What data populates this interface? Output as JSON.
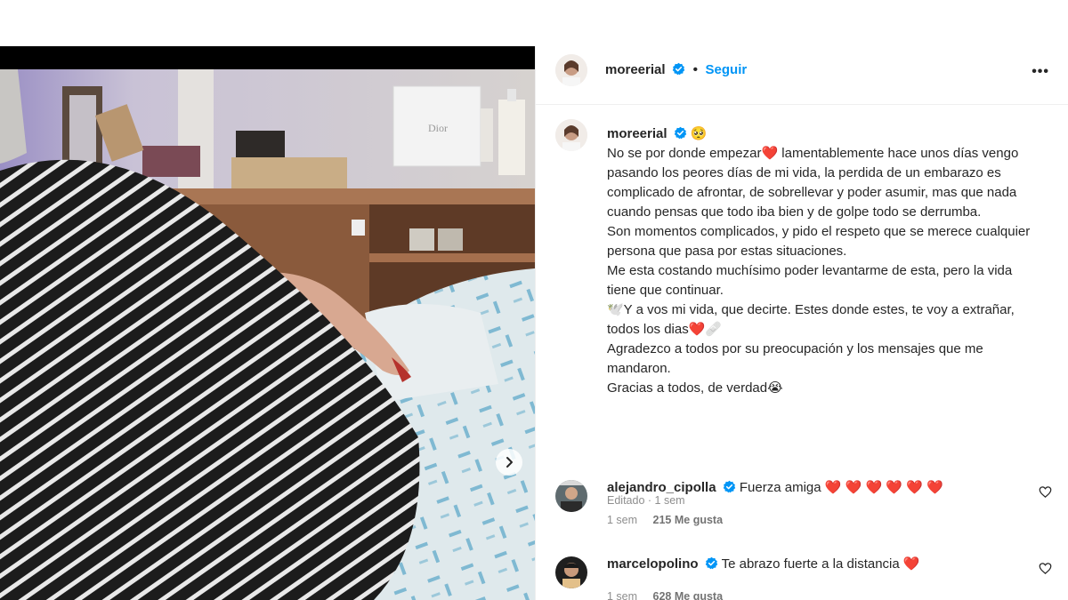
{
  "post": {
    "username": "moreerial",
    "follow_label": "Seguir",
    "more_label": "•••",
    "caption_emoji": "🥺",
    "caption_lines": [
      "No se por donde empezar❤️ lamentablemente hace unos días vengo pasando los peores días de mi vida, la perdida de un embarazo es complicado de afrontar, de sobrellevar y poder asumir, mas que nada cuando pensas que todo iba bien y de golpe todo se derrumba.",
      "Son momentos complicados, y pido el respeto que se merece cualquier persona que pasa por estas situaciones.",
      "Me esta costando muchísimo poder levantarme de esta, pero la vida tiene que continuar.",
      "🕊️Y a vos mi vida, que decirte. Estes donde estes, te voy a extrañar, todos los dias❤️🩹",
      "Agradezco a todos por su preocupación y los mensajes que me mandaron.",
      "Gracias a todos, de verdad😭"
    ],
    "edited_label": "Editado",
    "time_label": "1 sem"
  },
  "comments": [
    {
      "username": "alejandro_cipolla",
      "text": "Fuerza amiga ❤️ ❤️ ❤️ ❤️ ❤️ ❤️",
      "time": "1 sem",
      "likes": "215 Me gusta"
    },
    {
      "username": "marcelopolino",
      "text": "Te abrazo fuerte a la distancia ❤️",
      "time": "1 sem",
      "likes": "628 Me gusta"
    }
  ],
  "colors": {
    "accent": "#0095f6",
    "verified": "#0095f6",
    "heart": "#e0245e",
    "muted": "#8e8e8e"
  },
  "icons": {
    "verified": "verified-badge-icon",
    "next": "chevron-right-icon",
    "like": "heart-outline-icon",
    "more": "more-horizontal-icon"
  }
}
